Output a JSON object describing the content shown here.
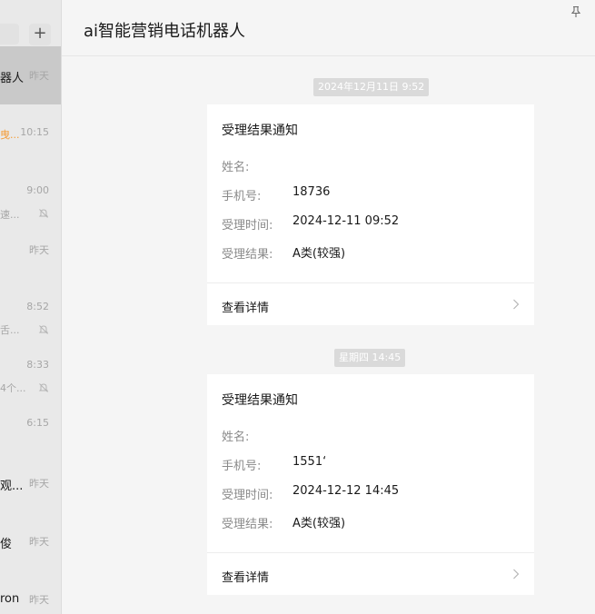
{
  "window": {
    "title": "ai智能营销电话机器人"
  },
  "sidebar": {
    "add_label": "+",
    "items": [
      {
        "name": "器人",
        "time": "昨天",
        "preview": ""
      },
      {
        "name": "",
        "time": "10:15",
        "preview": "曳..."
      },
      {
        "name": "",
        "time": "9:00",
        "preview": "速..."
      },
      {
        "name": "",
        "time": "昨天",
        "preview": ""
      },
      {
        "name": "",
        "time": "8:52",
        "preview": "舌..."
      },
      {
        "name": "",
        "time": "8:33",
        "preview": "4个..."
      },
      {
        "name": "",
        "time": "6:15",
        "preview": ""
      },
      {
        "name": "观...",
        "time": "昨天",
        "preview": ""
      },
      {
        "name": "俊",
        "time": "昨天",
        "preview": ""
      },
      {
        "name": "ron",
        "time": "昨天",
        "preview": ""
      }
    ]
  },
  "messages": [
    {
      "timestamp": "2024年12月11日 9:52",
      "card": {
        "title": "受理结果通知",
        "rows": [
          {
            "label": "姓名:",
            "value": ""
          },
          {
            "label": "手机号:",
            "value": "18736"
          },
          {
            "label": "受理时间:",
            "value": "2024-12-11 09:52"
          },
          {
            "label": "受理结果:",
            "value": "A类(较强)"
          }
        ],
        "detail_label": "查看详情"
      }
    },
    {
      "timestamp": "星期四 14:45",
      "card": {
        "title": "受理结果通知",
        "rows": [
          {
            "label": "姓名:",
            "value": ""
          },
          {
            "label": "手机号:",
            "value": "1551‘"
          },
          {
            "label": "受理时间:",
            "value": "2024-12-12 14:45"
          },
          {
            "label": "受理结果:",
            "value": "A类(较强)"
          }
        ],
        "detail_label": "查看详情"
      }
    }
  ],
  "icons": {
    "pin": "pin-icon",
    "mute": "mute-icon",
    "chevron": "chevron-right-icon"
  }
}
